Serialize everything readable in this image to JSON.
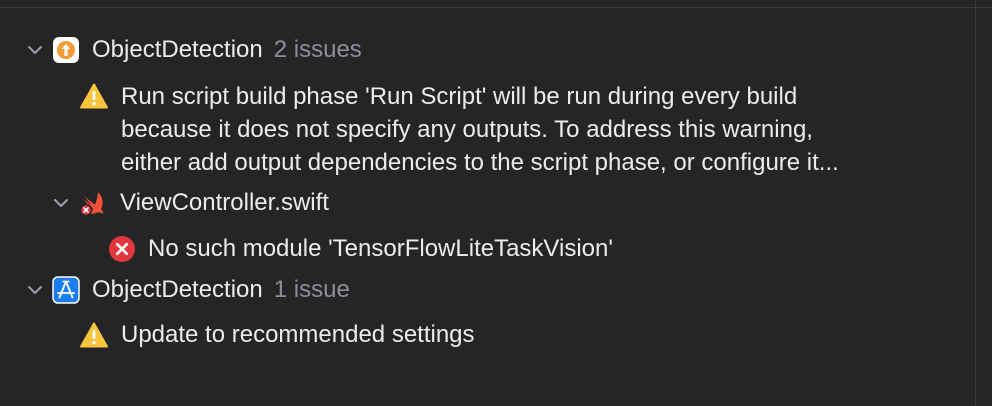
{
  "groups": [
    {
      "title": "ObjectDetection",
      "count": "2 issues",
      "warning": "Run script build phase 'Run Script' will be run during every build because it does not specify any outputs. To address this warning, either add output dependencies to the script phase, or configure it...",
      "warning_lines": [
        "Run script build phase 'Run Script' will be run during every build",
        "because it does not specify any outputs. To address this warning,",
        "either add output dependencies to the script phase, or configure it..."
      ],
      "file": {
        "name": "ViewController.swift",
        "error": "No such module 'TensorFlowLiteTaskVision'"
      }
    },
    {
      "title": "ObjectDetection",
      "count": "1 issue",
      "warning": "Update to recommended settings"
    }
  ],
  "colors": {
    "background": "#252528",
    "warning": "#f7c53e",
    "error": "#e0383e",
    "swift": "#f05138",
    "xcode_blue": "#1a7df0",
    "target_orange": "#f29a38"
  },
  "icons": [
    "chevron-down-icon",
    "target-icon",
    "warning-icon",
    "swift-file-icon",
    "error-icon",
    "app-project-icon"
  ]
}
